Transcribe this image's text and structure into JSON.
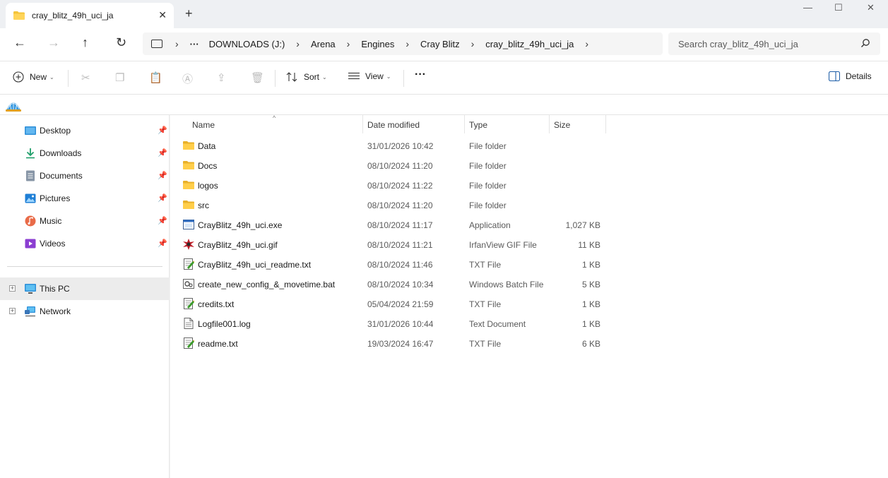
{
  "window": {
    "tab_title": "cray_blitz_49h_uci_ja",
    "close_tab_glyph": "✕",
    "new_tab_glyph": "+",
    "minimize_glyph": "—",
    "maximize_glyph": "☐",
    "close_glyph": "✕"
  },
  "nav": {
    "back_glyph": "←",
    "forward_glyph": "→",
    "up_glyph": "↑",
    "refresh_glyph": "↻"
  },
  "address": {
    "ellipsis": "···",
    "crumbs": [
      "DOWNLOADS (J:)",
      "Arena",
      "Engines",
      "Cray Blitz",
      "cray_blitz_49h_uci_ja"
    ],
    "separator": "›"
  },
  "search": {
    "placeholder": "Search cray_blitz_49h_uci_ja"
  },
  "toolbar": {
    "new_label": "New",
    "sort_label": "Sort",
    "view_label": "View",
    "more_label": "···",
    "details_label": "Details",
    "chevron": "⌄"
  },
  "sidebar": {
    "quick_access": [
      {
        "label": "Desktop",
        "icon": "desktop-icon"
      },
      {
        "label": "Downloads",
        "icon": "downloads-icon"
      },
      {
        "label": "Documents",
        "icon": "documents-icon"
      },
      {
        "label": "Pictures",
        "icon": "pictures-icon"
      },
      {
        "label": "Music",
        "icon": "music-icon"
      },
      {
        "label": "Videos",
        "icon": "videos-icon"
      }
    ],
    "pin_glyph": "📌",
    "this_pc": "This PC",
    "network": "Network",
    "expander_glyph": "+"
  },
  "columns": {
    "name": "Name",
    "date": "Date modified",
    "type": "Type",
    "size": "Size",
    "sort_glyph": "^"
  },
  "files": [
    {
      "name": "Data",
      "date": "31/01/2026 10:42",
      "type": "File folder",
      "size": "",
      "icon": "folder-icon"
    },
    {
      "name": "Docs",
      "date": "08/10/2024 11:20",
      "type": "File folder",
      "size": "",
      "icon": "folder-icon"
    },
    {
      "name": "logos",
      "date": "08/10/2024 11:22",
      "type": "File folder",
      "size": "",
      "icon": "folder-icon"
    },
    {
      "name": "src",
      "date": "08/10/2024 11:20",
      "type": "File folder",
      "size": "",
      "icon": "folder-icon"
    },
    {
      "name": "CrayBlitz_49h_uci.exe",
      "date": "08/10/2024 11:17",
      "type": "Application",
      "size": "1,027 KB",
      "icon": "exe-icon"
    },
    {
      "name": "CrayBlitz_49h_uci.gif",
      "date": "08/10/2024 11:21",
      "type": "IrfanView GIF File",
      "size": "11 KB",
      "icon": "gif-icon"
    },
    {
      "name": "CrayBlitz_49h_uci_readme.txt",
      "date": "08/10/2024 11:46",
      "type": "TXT File",
      "size": "1 KB",
      "icon": "txt-icon"
    },
    {
      "name": "create_new_config_&_movetime.bat",
      "date": "08/10/2024 10:34",
      "type": "Windows Batch File",
      "size": "5 KB",
      "icon": "bat-icon"
    },
    {
      "name": "credits.txt",
      "date": "05/04/2024 21:59",
      "type": "TXT File",
      "size": "1 KB",
      "icon": "txt-icon"
    },
    {
      "name": "Logfile001.log",
      "date": "31/01/2026 10:44",
      "type": "Text Document",
      "size": "1 KB",
      "icon": "log-icon"
    },
    {
      "name": "readme.txt",
      "date": "19/03/2024 16:47",
      "type": "TXT File",
      "size": "6 KB",
      "icon": "txt-icon"
    }
  ]
}
